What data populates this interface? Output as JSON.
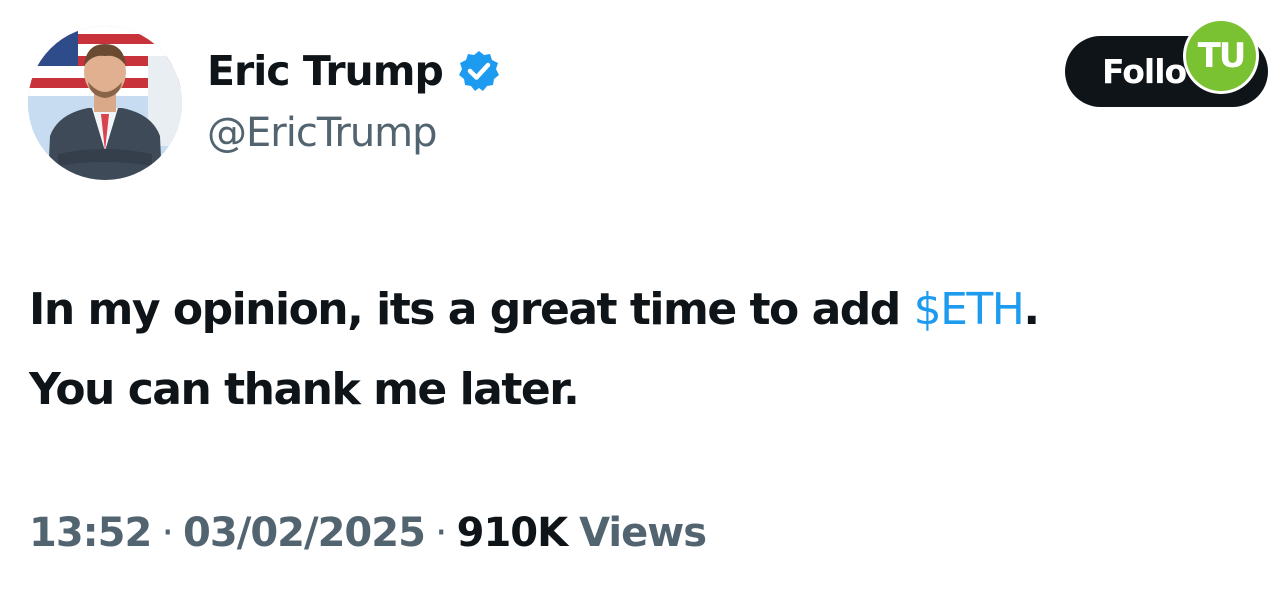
{
  "author": {
    "display_name": "Eric Trump",
    "handle": "@EricTrump",
    "verified": true
  },
  "follow_button": {
    "label": "Follo"
  },
  "watermark": {
    "text": "TU"
  },
  "tweet": {
    "line1_before": "In my opinion, its a great time to add ",
    "cashtag": "$ETH",
    "line1_after": ".",
    "line2": "You can thank me later."
  },
  "meta": {
    "time": "13:52",
    "separator": "·",
    "date": "03/02/2025",
    "view_count": "910K",
    "views_label": "Views"
  },
  "colors": {
    "text_primary": "#0f1419",
    "text_secondary": "#536471",
    "link_blue": "#1d9bf0",
    "verified_blue": "#1d9bf0",
    "follow_bg": "#0f1419",
    "watermark_green": "#7ac231"
  },
  "icons": {
    "verified": "verified-badge-icon"
  }
}
